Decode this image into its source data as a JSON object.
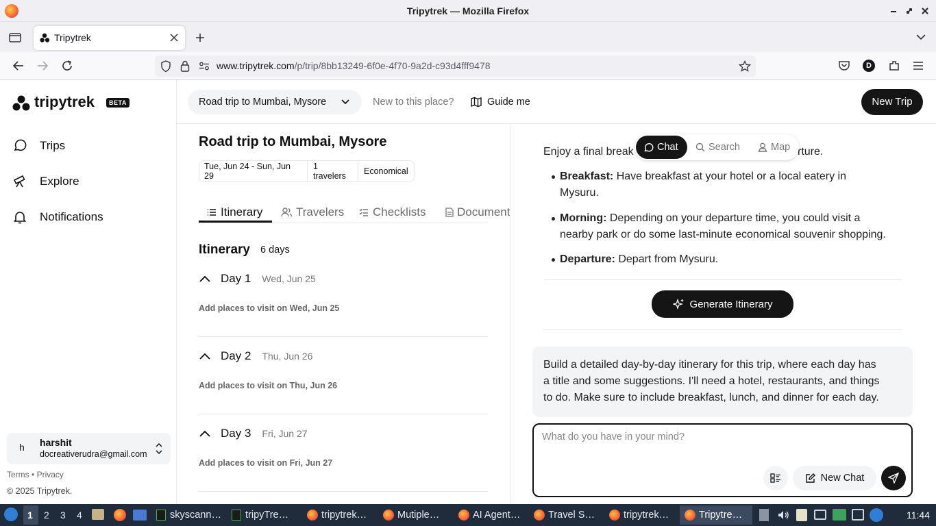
{
  "window": {
    "title": "Tripytrek — Mozilla Firefox"
  },
  "browser": {
    "tab_title": "Tripytrek",
    "url_domain": "www.tripytrek.com",
    "url_path": "/p/trip/8bb13249-6f0e-4f70-9a2d-c93d4fff9478"
  },
  "sidebar": {
    "logo": "tripytrek",
    "beta": "BETA",
    "items": [
      {
        "label": "Trips",
        "icon": "chat-bubble-icon"
      },
      {
        "label": "Explore",
        "icon": "telescope-icon"
      },
      {
        "label": "Notifications",
        "icon": "bell-icon"
      }
    ],
    "user": {
      "initial": "h",
      "name": "harshit",
      "email": "docreativerudra@gmail.com"
    },
    "footer_links": {
      "terms": "Terms",
      "sep": "•",
      "privacy": "Privacy"
    },
    "copyright": "© 2025 Tripytrek."
  },
  "header": {
    "trip_select": "Road trip to Mumbai, Mysore",
    "new_place": "New to this place?",
    "guide_me": "Guide me",
    "new_trip": "New Trip"
  },
  "trip": {
    "title": "Road trip to Mumbai, Mysore",
    "chips": [
      "Tue, Jun 24 - Sun, Jun 29",
      "1 travelers",
      "Economical"
    ],
    "tabs": [
      "Itinerary",
      "Travelers",
      "Checklists",
      "Document"
    ],
    "itinerary_label": "Itinerary",
    "days_count": "6 days",
    "days": [
      {
        "title": "Day 1",
        "date": "Wed, Jun 25",
        "add": "Add places to visit on Wed, Jun 25"
      },
      {
        "title": "Day 2",
        "date": "Thu, Jun 26",
        "add": "Add places to visit on Thu, Jun 26"
      },
      {
        "title": "Day 3",
        "date": "Fri, Jun 27",
        "add": "Add places to visit on Fri, Jun 27"
      }
    ]
  },
  "chat": {
    "segments": [
      "Chat",
      "Search",
      "Map"
    ],
    "intro_left": "Enjoy a final break",
    "intro_right": "rture.",
    "bullets": [
      {
        "label": "Breakfast:",
        "line1": " Have breakfast at your hotel or a local eatery in",
        "line2": "Mysuru."
      },
      {
        "label": "Morning:",
        "line1": " Depending on your departure time, you could visit a",
        "line2": "nearby park or do some last-minute economical souvenir shopping."
      },
      {
        "label": "Departure:",
        "line1": " Depart from Mysuru.",
        "line2": ""
      }
    ],
    "generate": "Generate Itinerary",
    "user_msg": [
      "Build a detailed day-by-day itinerary for this trip, where each day has",
      "a title and some suggestions. I'll need a hotel, restaurants, and things",
      "to do. Make sure to include breakfast, lunch, and dinner for each day."
    ],
    "input_placeholder": "What do you have in your mind?",
    "new_chat": "New Chat"
  },
  "taskbar": {
    "workspaces": [
      "1",
      "2",
      "3",
      "4"
    ],
    "apps": [
      "skyscann…",
      "tripyTre…",
      "tripytrek…",
      "Mutiple…",
      "AI Agent…",
      "Travel S…",
      "tripytrek…",
      "Tripytre…"
    ],
    "clock": "11:44"
  },
  "colors": {
    "dark": "#151515",
    "accent_ff": "#ff6a2b",
    "taskbar": "#202c3c"
  }
}
